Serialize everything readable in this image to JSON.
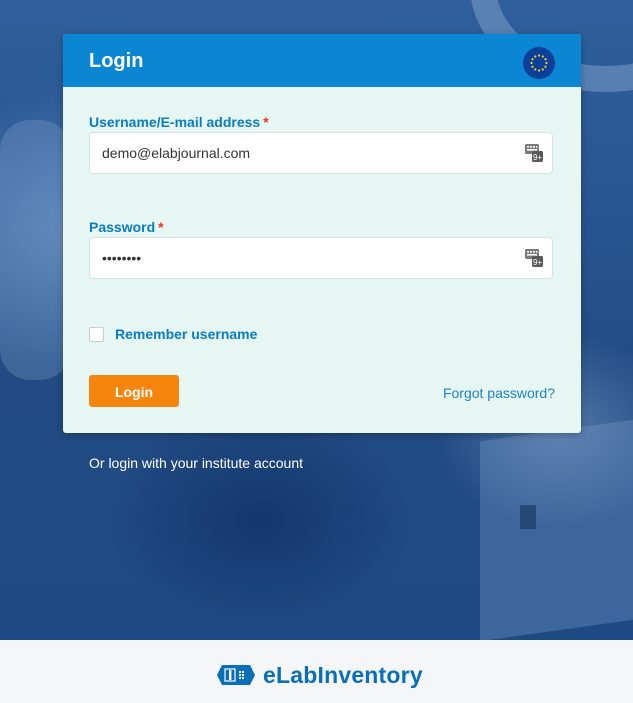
{
  "login_card": {
    "title": "Login",
    "language_icon": "eu-flag-icon",
    "username": {
      "label": "Username/E-mail address",
      "required_mark": "*",
      "value": "demo@elabjournal.com",
      "icon": "keyboard-icon"
    },
    "password": {
      "label": "Password",
      "required_mark": "*",
      "value": "demopass",
      "icon": "keyboard-icon"
    },
    "remember": {
      "label": "Remember username",
      "checked": false
    },
    "login_button": "Login",
    "forgot_password": "Forgot password?"
  },
  "institute_login": "Or login with your institute account",
  "footer": {
    "brand_icon": "elab-logo-icon",
    "brand_name": "eLabInventory"
  },
  "colors": {
    "header_blue": "#0a86d3",
    "label_blue": "#0a7cc0",
    "button_orange": "#f6850e",
    "card_bg": "#e6f6f2",
    "brand_blue": "#0b6fb8"
  }
}
